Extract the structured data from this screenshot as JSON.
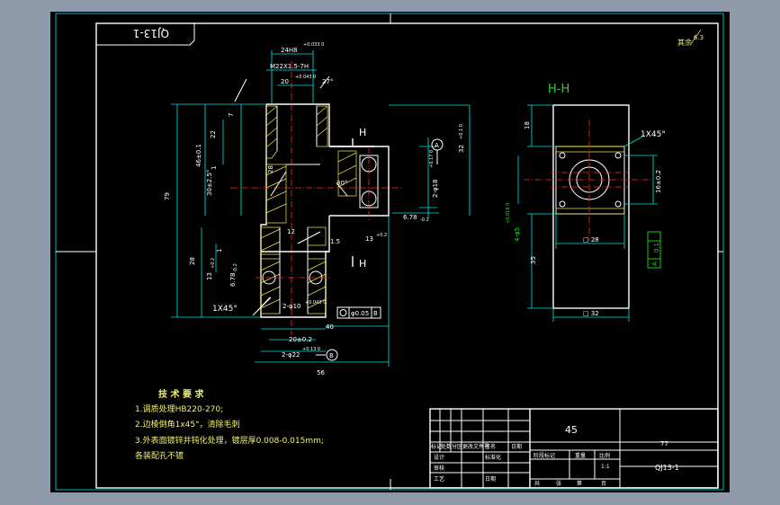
{
  "drawing": {
    "code_box": "QJ13-1",
    "roughness_note": "其余",
    "roughness_value": "6.3",
    "section_title": "H-H",
    "section_mark": "H"
  },
  "main_view": {
    "dims": {
      "d24": "24H8",
      "d24_tol": "+0.033 0",
      "thread": "M22X1.5-7H",
      "d20": "20",
      "d20_tol": "+0.043 0",
      "len7": "7",
      "len22": "22",
      "h46": "46±0.1",
      "one": "1",
      "angle30": "30±2.5°",
      "h79": "79",
      "len12": "12",
      "h28": "28",
      "one_b": "1",
      "h13": "13",
      "h13_tol": "+0.2",
      "h6_78": "6.78",
      "h6_78_tol": "-0.2",
      "chamfer": "1X45°",
      "holes": "2-φ10",
      "holes_tol": "+0.043 0",
      "pos_tol": "φ0.05",
      "datum_b": "B",
      "len20": "20±0.2",
      "len40": "40",
      "holes_22": "2-φ22",
      "holes_22_tol": "+0.13 0",
      "len56": "56",
      "len1_5": "1.5",
      "d6_78r": "6.78",
      "d6_78r_tol": "-0.2",
      "h13r": "13",
      "h13r_tol": "+0.2",
      "holes2_r": "2-φ18",
      "holes2_r_tol": "+0.17 0",
      "h32": "32",
      "h32_tol": "+0.1 0",
      "d28": "28",
      "ang30": "30°",
      "ang27": "27°",
      "datum_a": "A"
    }
  },
  "section_view": {
    "dims": {
      "h18": "18",
      "chamfer": "1X45°",
      "h16": "16±0.2",
      "holes": "4-φ5",
      "holes_tol": "+0.018 0",
      "h35": "35",
      "w28": "□ 28",
      "w32": "□ 32",
      "flat": "0.1",
      "datum": "A"
    }
  },
  "tech_req": {
    "title": "技 术 要 求",
    "lines": [
      "1.调质处理HB220-270;",
      "2.边棱倒角1x45°，清除毛刺",
      "3.外表面镀锌并钝化处理，镀层厚0.008-0.015mm;",
      "  各装配孔不镀"
    ]
  },
  "title_block": {
    "material": "45",
    "drawing_no": "QJ13-1",
    "part_name": "77",
    "scale": "1:1",
    "labels": {
      "mark": "标记",
      "count": "处数",
      "zone": "分区",
      "change_no": "更改文件号",
      "sign": "签名",
      "date": "日期",
      "design": "设计",
      "standard": "标准化",
      "stage": "阶段标记",
      "weight": "重量",
      "ratio": "比例",
      "review": "审核",
      "process": "工艺",
      "approve": "日期",
      "total": "共",
      "sheet_word": "张",
      "of": "第",
      "page": "页"
    }
  }
}
